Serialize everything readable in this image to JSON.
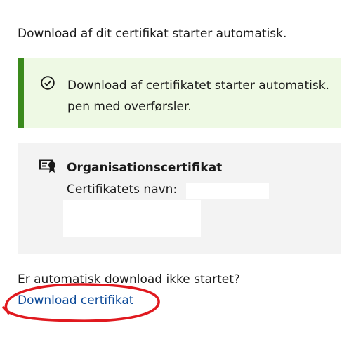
{
  "intro_text": "Download af dit certifikat starter automatisk.",
  "alert": {
    "message_line1": "Download af certifikatet starter automatisk.",
    "message_line2": "pen med overførsler.",
    "icon": "check-circle-icon",
    "accent_color": "#3a8a1c",
    "background_color": "#eef9e4"
  },
  "certificate": {
    "icon": "certificate-icon",
    "title": "Organisationscertifikat",
    "name_label": "Certifikatets navn:",
    "background_color": "#f3f3f3"
  },
  "fallback": {
    "question": "Er automatisk download ikke startet?",
    "link_label": "Download certifikat",
    "link_color": "#0f4c9a"
  },
  "annotation": {
    "shape": "ellipse",
    "color": "#e0191f"
  }
}
